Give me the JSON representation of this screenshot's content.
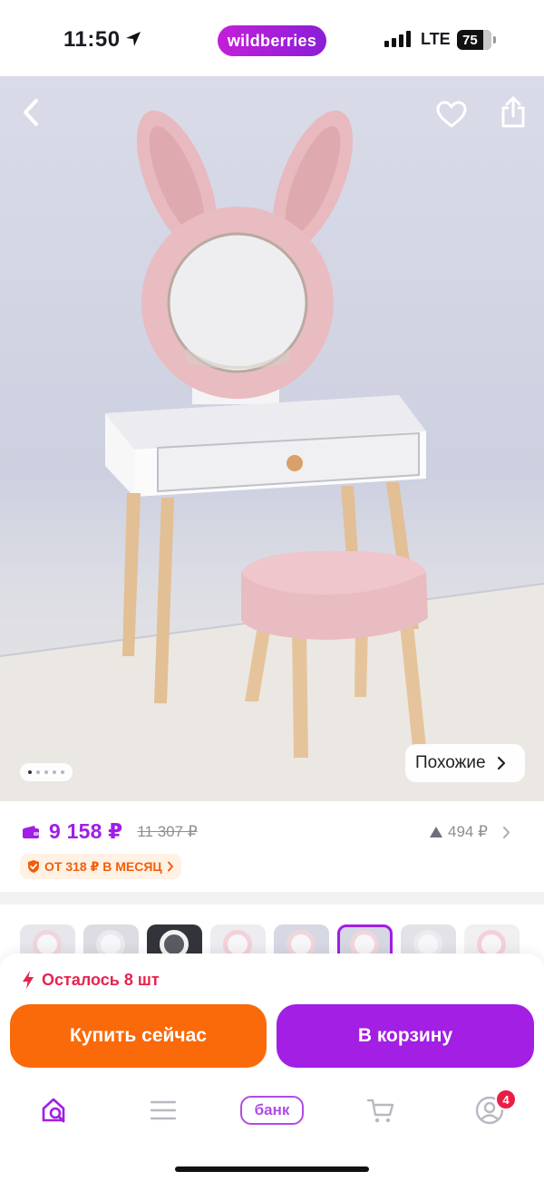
{
  "status_bar": {
    "time": "11:50",
    "brand": "wildberries",
    "network": "LTE",
    "battery": "75"
  },
  "hero": {
    "similar_label": "Похожие",
    "image_count": 5,
    "active_image": 1
  },
  "price": {
    "current": "9 158 ₽",
    "old": "11 307 ₽",
    "points": "494 ₽",
    "installment": "ОТ 318 ₽ В МЕСЯЦ"
  },
  "thumbnails": {
    "count": 8,
    "selected_index": 5
  },
  "purchase": {
    "stock_text": "Осталось 8 шт",
    "buy_now_label": "Купить сейчас",
    "add_to_cart_label": "В корзину"
  },
  "tabbar": {
    "bank_label": "банк",
    "profile_badge": "4"
  },
  "colors": {
    "brand_purple": "#a01ee5",
    "buy_orange": "#fa6a0a",
    "stock_red": "#e5244e",
    "installment_orange": "#f25f0a"
  }
}
